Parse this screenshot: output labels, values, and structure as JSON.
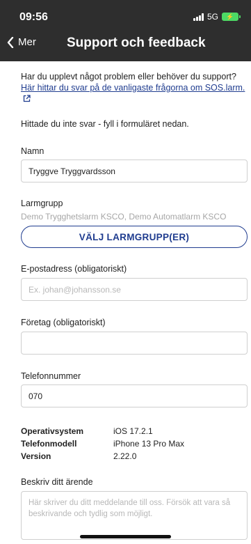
{
  "status_bar": {
    "time": "09:56",
    "network": "5G",
    "battery_icon": "battery-charging-icon",
    "signal_icon": "signal-bars-icon"
  },
  "nav": {
    "back_label": "Mer",
    "back_icon": "chevron-left-icon",
    "title": "Support och feedback"
  },
  "intro": {
    "question": "Har du upplevt något problem eller behöver du support?",
    "faq_link": "Här hittar du svar på de vanligaste frågorna om SOS.larm.",
    "link_icon": "external-link-icon",
    "not_found": "Hittade du inte svar - fyll i formuläret nedan."
  },
  "form": {
    "name": {
      "label": "Namn",
      "value": "Tryggve Tryggvardsson"
    },
    "alarm_group": {
      "label": "Larmgrupp",
      "selected": "Demo Trygghetslarm KSCO, Demo Automatlarm KSCO",
      "button": "VÄLJ LARMGRUPP(ER)"
    },
    "email": {
      "label": "E-postadress (obligatoriskt)",
      "placeholder": "Ex. johan@johansson.se",
      "value": ""
    },
    "company": {
      "label": "Företag (obligatoriskt)",
      "value": ""
    },
    "phone": {
      "label": "Telefonnummer",
      "value": "070"
    },
    "device_info": [
      {
        "key": "Operativsystem",
        "value": "iOS 17.2.1"
      },
      {
        "key": "Telefonmodell",
        "value": "iPhone 13 Pro Max"
      },
      {
        "key": "Version",
        "value": "2.22.0"
      }
    ],
    "description": {
      "label": "Beskriv ditt ärende",
      "placeholder": "Här skriver du ditt meddelande till oss. Försök att vara så beskrivande och tydlig som möjligt."
    }
  },
  "colors": {
    "header_bg": "#2e2e2e",
    "accent": "#1f3c8f",
    "battery": "#4cd964"
  }
}
